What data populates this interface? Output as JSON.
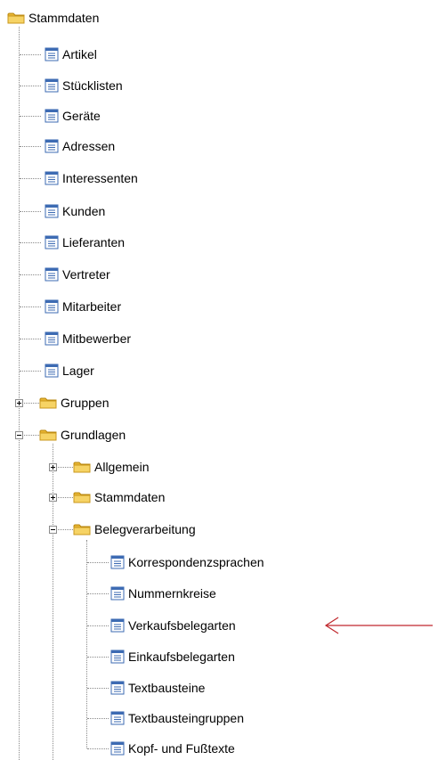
{
  "tree": {
    "root": {
      "label": "Stammdaten",
      "icon": "folder-icon"
    },
    "stammdaten_items": [
      {
        "label": "Artikel",
        "icon": "document-icon"
      },
      {
        "label": "Stücklisten",
        "icon": "document-icon"
      },
      {
        "label": "Geräte",
        "icon": "document-icon"
      },
      {
        "label": "Adressen",
        "icon": "document-icon"
      },
      {
        "label": "Interessenten",
        "icon": "document-icon"
      },
      {
        "label": "Kunden",
        "icon": "document-icon"
      },
      {
        "label": "Lieferanten",
        "icon": "document-icon"
      },
      {
        "label": "Vertreter",
        "icon": "document-icon"
      },
      {
        "label": "Mitarbeiter",
        "icon": "document-icon"
      },
      {
        "label": "Mitbewerber",
        "icon": "document-icon"
      },
      {
        "label": "Lager",
        "icon": "document-icon"
      }
    ],
    "gruppen": {
      "label": "Gruppen",
      "state": "collapsed"
    },
    "grundlagen": {
      "label": "Grundlagen",
      "state": "expanded"
    },
    "grundlagen_items": [
      {
        "label": "Allgemein",
        "state": "collapsed"
      },
      {
        "label": "Stammdaten",
        "state": "collapsed"
      },
      {
        "label": "Belegverarbeitung",
        "state": "expanded"
      }
    ],
    "belegverarbeitung_items": [
      {
        "label": "Korrespondenzsprachen"
      },
      {
        "label": "Nummernkreise"
      },
      {
        "label": "Verkaufsbelegarten",
        "highlighted_by_arrow": true
      },
      {
        "label": "Einkaufsbelegarten"
      },
      {
        "label": "Textbausteine"
      },
      {
        "label": "Textbausteingruppen"
      },
      {
        "label": "Kopf- und Fußtexte"
      }
    ]
  },
  "colors": {
    "arrow": "#c0282d",
    "folder": "#f2c94c",
    "doc_icon": "#3d6bb3",
    "connector": "#8a8a8a"
  }
}
